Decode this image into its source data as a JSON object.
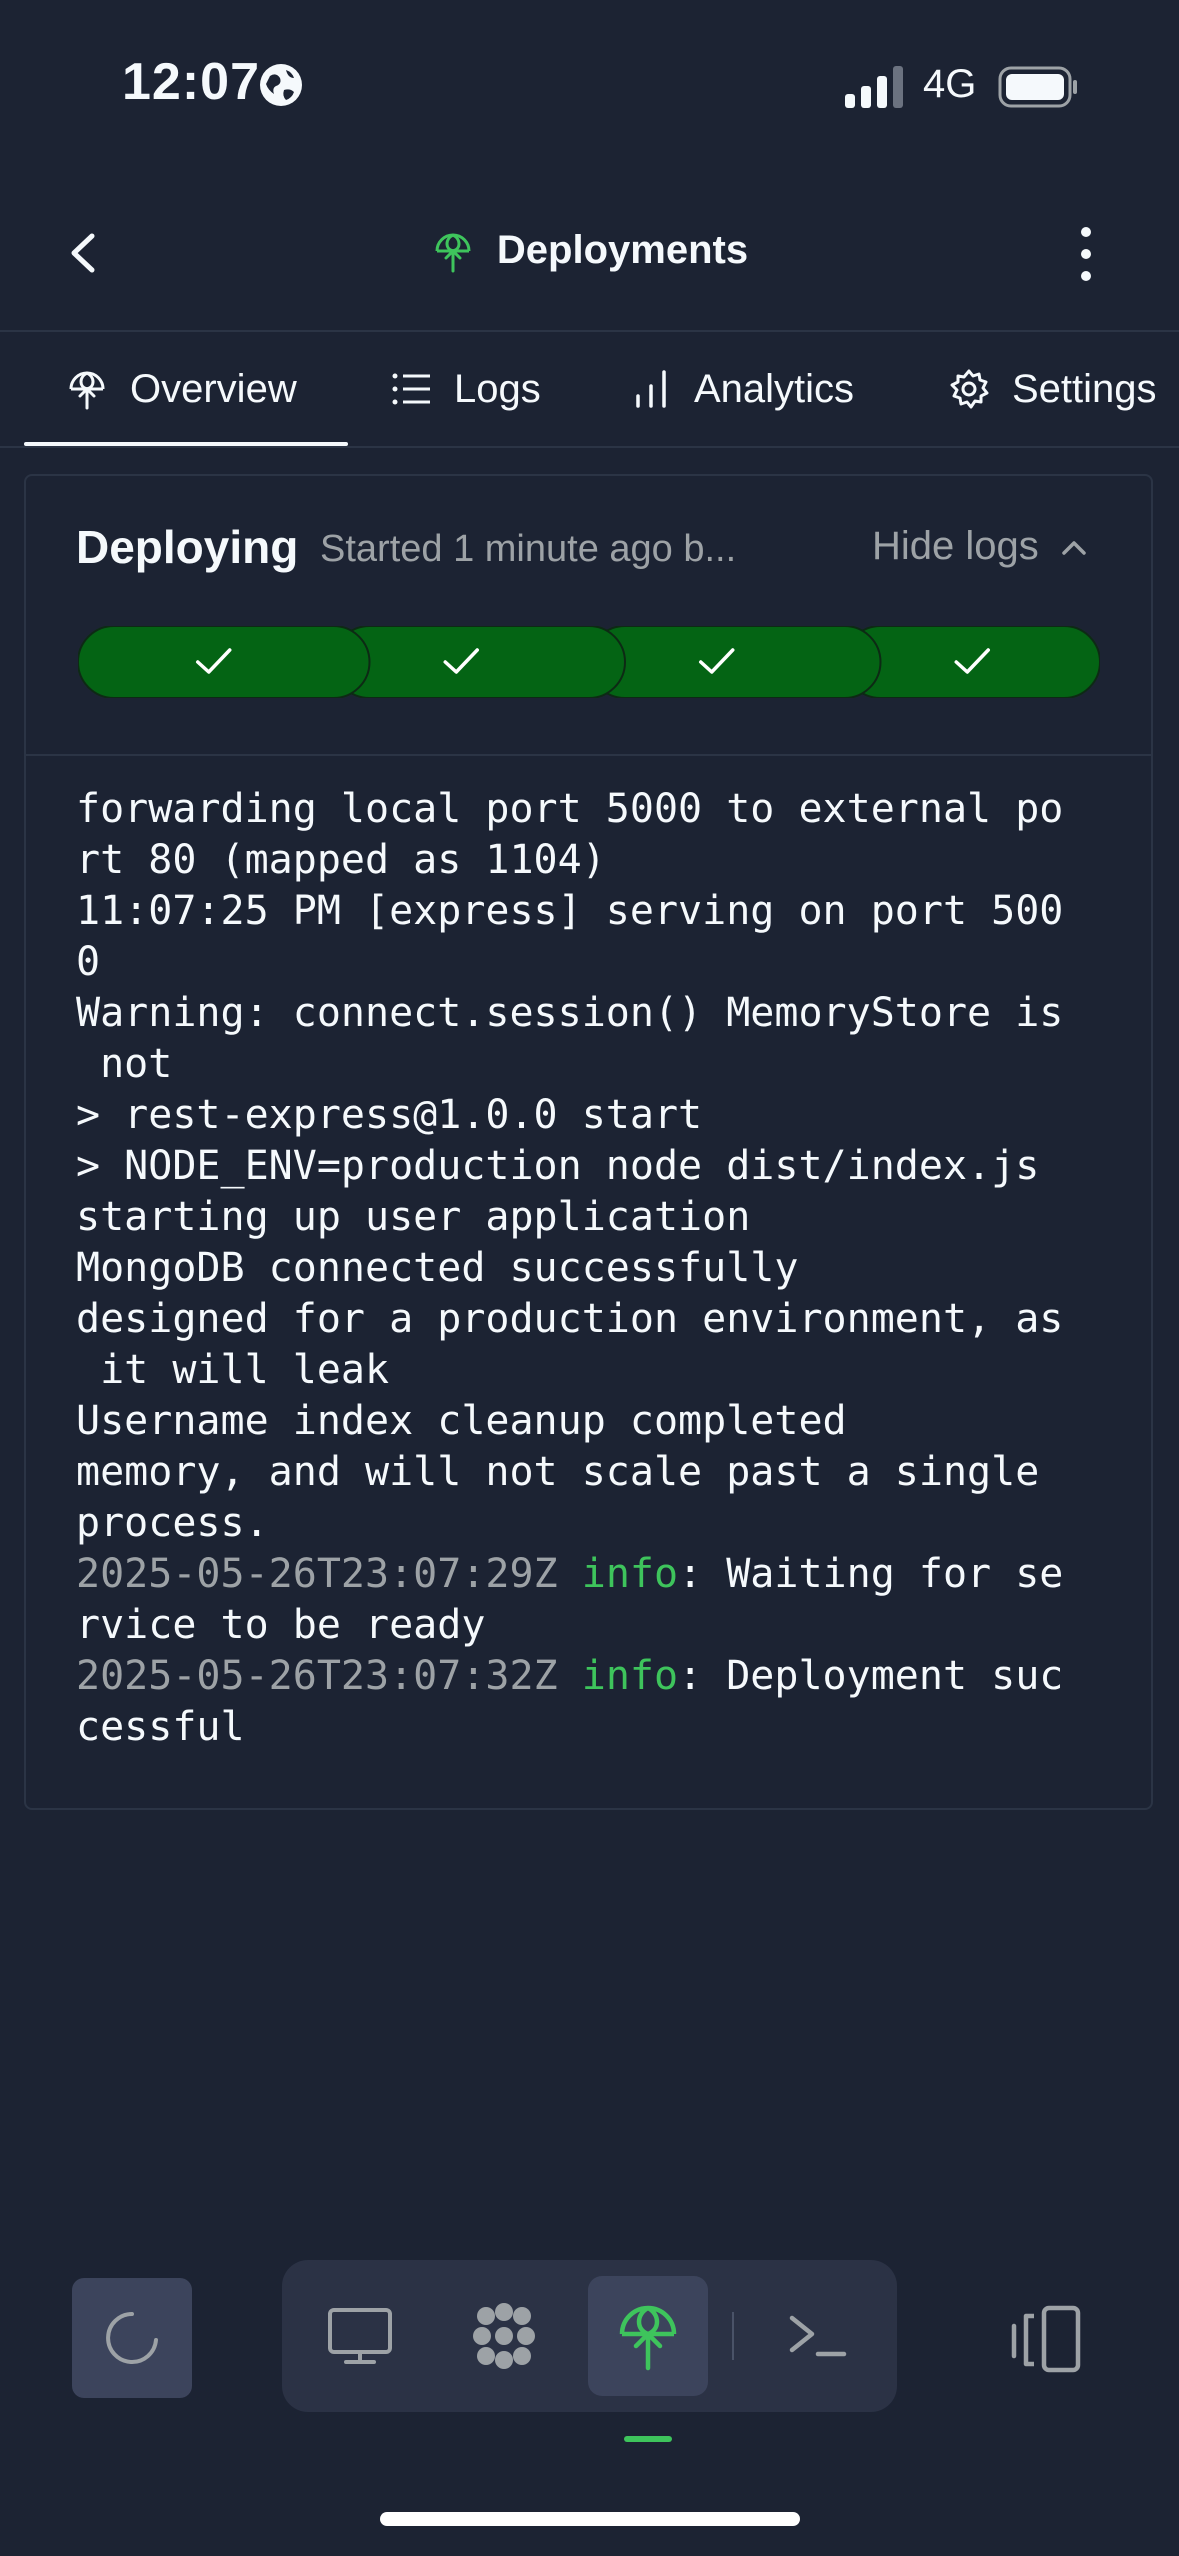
{
  "status_bar": {
    "time": "12:07",
    "network": "4G"
  },
  "header": {
    "title": "Deployments"
  },
  "tabs": [
    {
      "label": "Overview",
      "active": true
    },
    {
      "label": "Logs"
    },
    {
      "label": "Analytics"
    },
    {
      "label": "Settings"
    }
  ],
  "deploy": {
    "status": "Deploying",
    "subtitle": "Started 1 minute ago b...",
    "hide_logs_label": "Hide logs",
    "steps_completed": 4,
    "steps_total": 4
  },
  "log": {
    "lines": [
      {
        "text": "forwarding local port 5000 to external po"
      },
      {
        "text": "rt 80 (mapped as 1104)"
      },
      {
        "text": "11:07:25 PM [express] serving on port 500"
      },
      {
        "text": "0"
      },
      {
        "text": "Warning: connect.session() MemoryStore is"
      },
      {
        "text": " not"
      },
      {
        "text": "> rest-express@1.0.0 start"
      },
      {
        "text": "> NODE_ENV=production node dist/index.js"
      },
      {
        "text": "starting up user application"
      },
      {
        "text": "MongoDB connected successfully"
      },
      {
        "text": "designed for a production environment, as"
      },
      {
        "text": " it will leak"
      },
      {
        "text": "Username index cleanup completed"
      },
      {
        "text": "memory, and will not scale past a single"
      },
      {
        "text": "process."
      },
      {
        "timestamp": "2025-05-26T23:07:29Z",
        "level": "info",
        "text": ": Waiting for se"
      },
      {
        "text": "rvice to be ready"
      },
      {
        "timestamp": "2025-05-26T23:07:32Z",
        "level": "info",
        "text": ": Deployment suc"
      },
      {
        "text": "cessful"
      }
    ]
  },
  "colors": {
    "background": "#1c2333",
    "accent_green": "#3ec45c",
    "step_green": "#046414",
    "muted_text": "#9da2a6"
  },
  "bottom_nav": {
    "items": [
      {
        "icon": "loading-spinner-icon"
      },
      {
        "icon": "desktop-icon"
      },
      {
        "icon": "tools-grid-icon"
      },
      {
        "icon": "deployments-icon",
        "active": true
      },
      {
        "icon": "shell-icon"
      },
      {
        "icon": "devices-icon"
      }
    ]
  }
}
